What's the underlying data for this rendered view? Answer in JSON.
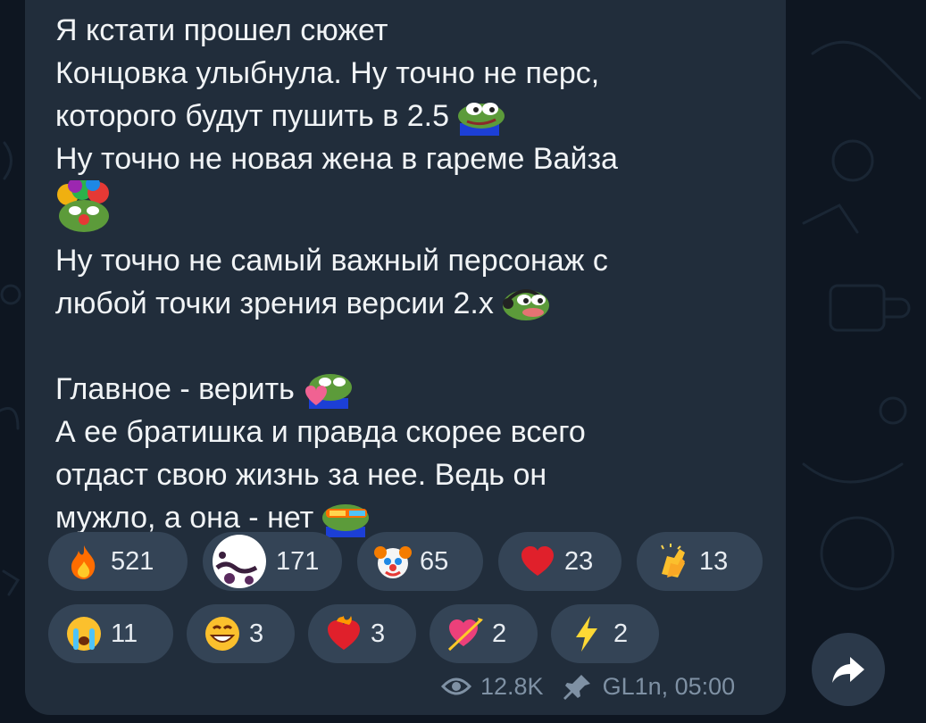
{
  "message": {
    "lines": [
      "Я кстати прошел сюжет",
      "Концовка улыбнула. Ну точно не перс,",
      "которого будут пушить в 2.5",
      "Ну точно не новая жена в гареме Вайза",
      "Ну точно не самый важный персонаж с",
      "любой точки зрения версии 2.х",
      "Главное - верить",
      "А ее братишка и правда скорее всего",
      "отдаст свою жизнь за нее. Ведь он",
      "мужло, а она - нет"
    ]
  },
  "reactions": [
    {
      "icon": "fire-icon",
      "count": "521"
    },
    {
      "icon": "custom-sticker-icon",
      "count": "171"
    },
    {
      "icon": "clown-face-icon",
      "count": "65"
    },
    {
      "icon": "red-heart-icon",
      "count": "23"
    },
    {
      "icon": "clapping-hands-icon",
      "count": "13"
    },
    {
      "icon": "crying-face-icon",
      "count": "11"
    },
    {
      "icon": "grinning-face-icon",
      "count": "3"
    },
    {
      "icon": "heart-on-fire-icon",
      "count": "3"
    },
    {
      "icon": "heart-with-arrow-icon",
      "count": "2"
    },
    {
      "icon": "high-voltage-icon",
      "count": "2"
    }
  ],
  "meta": {
    "views": "12.8K",
    "author_time": "GL1n, 05:00"
  },
  "colors": {
    "background": "#0e1621",
    "bubble": "#212d3b",
    "chip": "#344456",
    "meta_text": "#7f91a4"
  }
}
